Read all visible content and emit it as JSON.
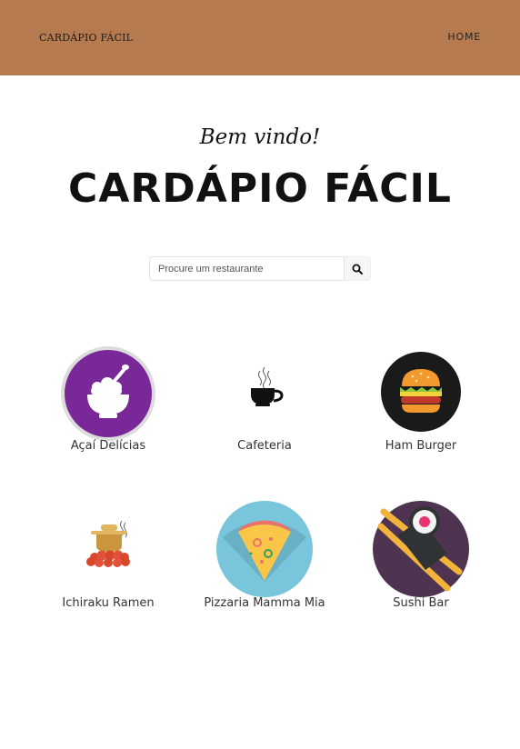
{
  "navbar": {
    "brand": "CARDÁPIO FÁCIL",
    "home_link": "HOME",
    "background": "#b57a4f"
  },
  "hero": {
    "welcome": "Bem vindo!",
    "title": "CARDÁPIO FÁCIL"
  },
  "search": {
    "placeholder": "Procure um restaurante",
    "button_icon": "search-icon"
  },
  "restaurants": [
    {
      "name": "Açaí Delícias",
      "icon": "acai-bowl-icon"
    },
    {
      "name": "Cafeteria",
      "icon": "coffee-cup-icon"
    },
    {
      "name": "Ham Burger",
      "icon": "burger-icon"
    },
    {
      "name": "Ichiraku Ramen",
      "icon": "ramen-pot-icon"
    },
    {
      "name": "Pizzaria Mamma Mia",
      "icon": "pizza-slice-icon"
    },
    {
      "name": "Sushi Bar",
      "icon": "sushi-chopsticks-icon"
    }
  ]
}
